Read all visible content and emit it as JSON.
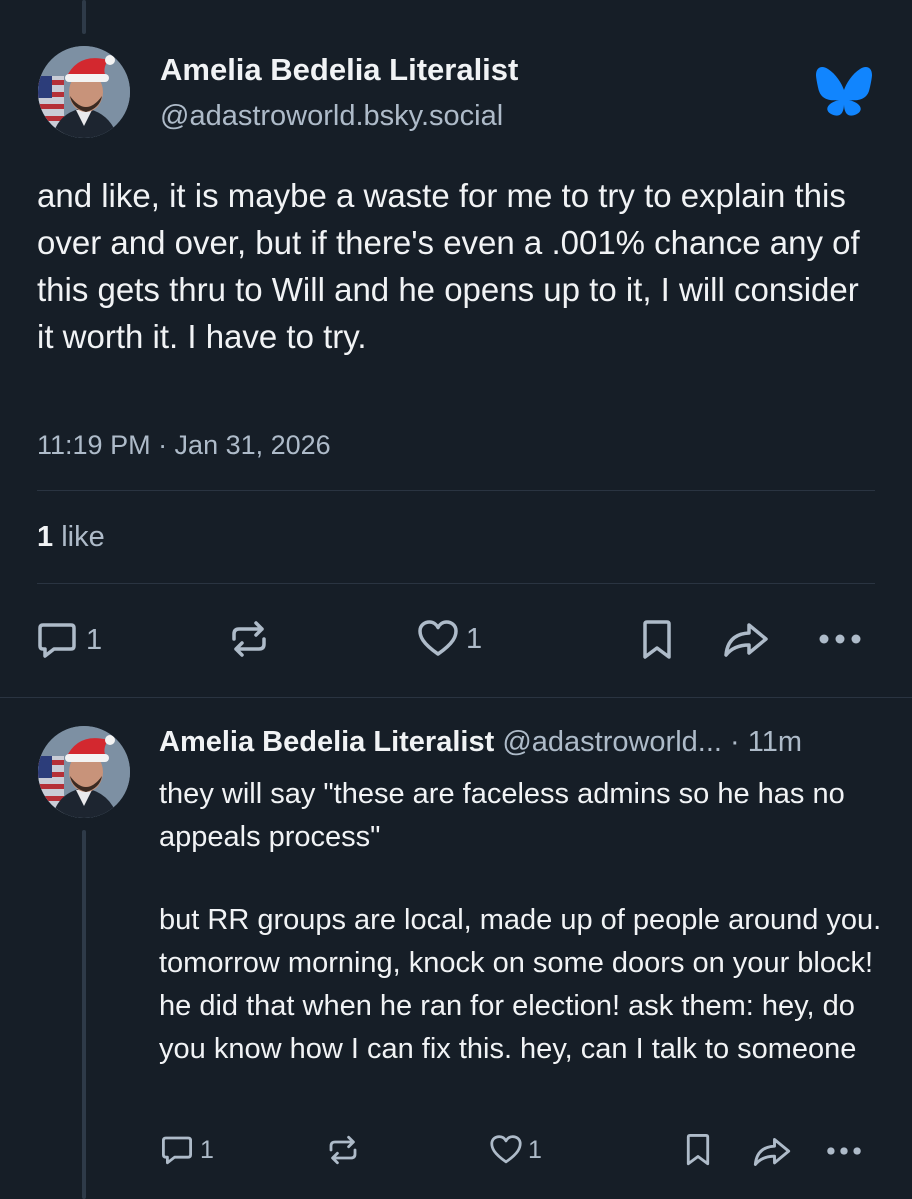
{
  "colors": {
    "background": "#161e27",
    "text": "#f1f3f5",
    "muted": "#aebbc9",
    "divider": "#2a3441",
    "bluesky_blue": "#1185fe"
  },
  "main_post": {
    "author_name": "Amelia Bedelia Literalist",
    "author_handle": "@adastroworld.bsky.social",
    "logo_icon": "bluesky-butterfly-icon",
    "text": "and like, it is maybe a waste for me to try to explain this over and over, but if there's even a .001% chance any of this gets thru to Will and he opens up to it, I will consider it worth it. I have to try.",
    "timestamp": "11:19 PM · Jan 31, 2026",
    "likes_count": "1",
    "likes_label": "like",
    "actions": {
      "reply_count": "1",
      "repost_count": "",
      "like_count": "1"
    }
  },
  "reply_post": {
    "author_name": "Amelia Bedelia Literalist",
    "author_handle": "@adastroworld...",
    "time_ago": "· 11m",
    "text_paragraph_1": "they will say \"these are faceless admins so he has no appeals process\"",
    "text_paragraph_2": "but RR groups are local, made up of people around you. tomorrow morning, knock on some doors on your block! he did that when he ran for election! ask them: hey, do you know how I can fix this. hey, can I talk to someone",
    "actions": {
      "reply_count": "1",
      "repost_count": "",
      "like_count": "1"
    }
  }
}
